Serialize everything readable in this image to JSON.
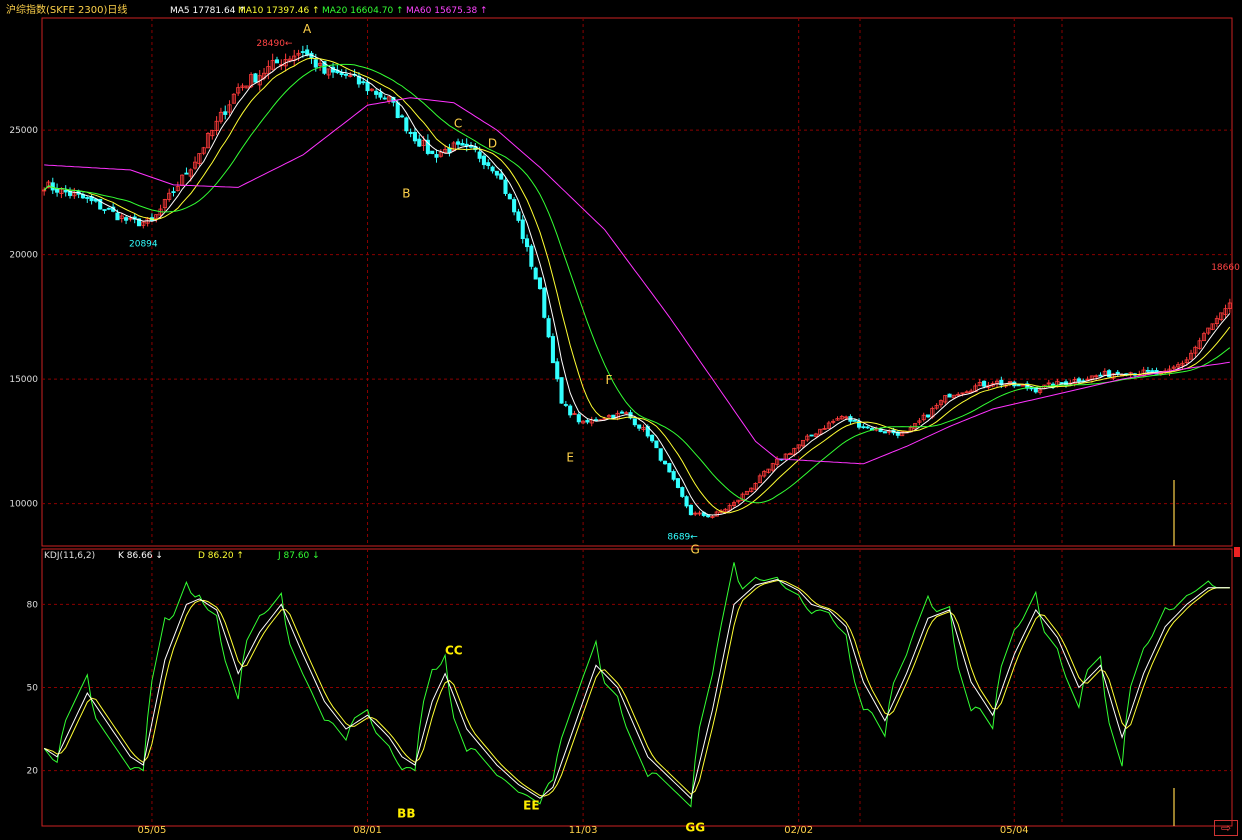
{
  "header": {
    "title": "沪综指数(SKFE 2300)日线",
    "ma_labels": [
      {
        "name": "MA5",
        "value": "17781.64",
        "arrow": "↑",
        "color": "#ffffff"
      },
      {
        "name": "MA10",
        "value": "17397.46",
        "arrow": "↑",
        "color": "#ffff33"
      },
      {
        "name": "MA20",
        "value": "16604.70",
        "arrow": "↑",
        "color": "#33ff33"
      },
      {
        "name": "MA60",
        "value": "15675.38",
        "arrow": "↑",
        "color": "#ff44ff"
      }
    ]
  },
  "kdj_header": {
    "title": "KDJ(11,6,2)",
    "values": [
      {
        "name": "K",
        "value": "86.66",
        "arrow": "↓",
        "color": "#ffffff"
      },
      {
        "name": "D",
        "value": "86.20",
        "arrow": "↑",
        "color": "#ffff33"
      },
      {
        "name": "J",
        "value": "87.60",
        "arrow": "↓",
        "color": "#33ff33"
      }
    ]
  },
  "colors": {
    "up": "#ff3b3b",
    "down": "#33ffff",
    "ma5": "#ffffff",
    "ma10": "#ffff33",
    "ma20": "#33ff33",
    "ma60": "#ff33ff",
    "grid": "#8b0000",
    "axis": "#cc2222",
    "label": "#ffd24a"
  },
  "chart_data": [
    {
      "type": "candlestick",
      "ylim": [
        8300,
        29500
      ],
      "yticks": [
        10000,
        15000,
        20000,
        25000
      ],
      "xticks": [
        "05/05",
        "08/01",
        "11/03",
        "02/02",
        "05/04"
      ],
      "xtick_index": [
        25,
        75,
        125,
        175,
        225
      ],
      "n_bars": 276,
      "close_anchors": [
        [
          0,
          22800
        ],
        [
          10,
          22200
        ],
        [
          20,
          21300
        ],
        [
          25,
          21300
        ],
        [
          35,
          23800
        ],
        [
          45,
          26700
        ],
        [
          55,
          27800
        ],
        [
          60,
          28200
        ],
        [
          65,
          27300
        ],
        [
          70,
          27200
        ],
        [
          80,
          26200
        ],
        [
          85,
          24900
        ],
        [
          90,
          24000
        ],
        [
          95,
          24300
        ],
        [
          100,
          24100
        ],
        [
          105,
          23400
        ],
        [
          110,
          21300
        ],
        [
          115,
          18500
        ],
        [
          120,
          14000
        ],
        [
          125,
          13200
        ],
        [
          130,
          13500
        ],
        [
          135,
          13600
        ],
        [
          140,
          12800
        ],
        [
          150,
          9600
        ],
        [
          155,
          9500
        ],
        [
          160,
          10000
        ],
        [
          170,
          11700
        ],
        [
          180,
          13000
        ],
        [
          185,
          13500
        ],
        [
          190,
          13100
        ],
        [
          195,
          12900
        ],
        [
          200,
          12800
        ],
        [
          210,
          14400
        ],
        [
          220,
          14900
        ],
        [
          230,
          14600
        ],
        [
          240,
          15000
        ],
        [
          250,
          15300
        ],
        [
          260,
          15200
        ],
        [
          265,
          15800
        ],
        [
          270,
          17000
        ],
        [
          275,
          17900
        ]
      ],
      "ma60_anchors": [
        [
          0,
          23600
        ],
        [
          20,
          23400
        ],
        [
          30,
          22800
        ],
        [
          45,
          22700
        ],
        [
          60,
          24000
        ],
        [
          75,
          26000
        ],
        [
          85,
          26300
        ],
        [
          95,
          26100
        ],
        [
          105,
          25000
        ],
        [
          115,
          23500
        ],
        [
          130,
          21000
        ],
        [
          145,
          17500
        ],
        [
          155,
          15000
        ],
        [
          165,
          12500
        ],
        [
          170,
          11800
        ],
        [
          180,
          11700
        ],
        [
          190,
          11600
        ],
        [
          200,
          12300
        ],
        [
          210,
          13100
        ],
        [
          220,
          13800
        ],
        [
          235,
          14400
        ],
        [
          250,
          15000
        ],
        [
          260,
          15300
        ],
        [
          276,
          15700
        ]
      ],
      "price_labels": [
        {
          "text": "28490",
          "index": 59,
          "value": 28490,
          "color": "#ff4444",
          "side": "left"
        },
        {
          "text": "20894",
          "index": 23,
          "value": 20894,
          "color": "#33ffff",
          "side": "below"
        },
        {
          "text": "8689",
          "index": 153,
          "value": 8689,
          "color": "#33ffff",
          "side": "left"
        },
        {
          "text": "18660",
          "index": 274,
          "value": 18660,
          "color": "#ff4444",
          "side": "above"
        }
      ],
      "annotations": [
        {
          "text": "A",
          "index": 61,
          "value": 28900
        },
        {
          "text": "B",
          "index": 84,
          "value": 22300
        },
        {
          "text": "C",
          "index": 96,
          "value": 25100
        },
        {
          "text": "D",
          "index": 104,
          "value": 24300
        },
        {
          "text": "E",
          "index": 122,
          "value": 11700
        },
        {
          "text": "F",
          "index": 131,
          "value": 14800
        },
        {
          "text": "G",
          "index": 151,
          "value": 8000
        }
      ]
    },
    {
      "type": "line",
      "ylim": [
        0,
        100
      ],
      "yticks": [
        20,
        50,
        80
      ],
      "k_anchors": [
        [
          0,
          28
        ],
        [
          3,
          25
        ],
        [
          10,
          48
        ],
        [
          20,
          25
        ],
        [
          23,
          22
        ],
        [
          28,
          60
        ],
        [
          33,
          80
        ],
        [
          36,
          82
        ],
        [
          40,
          78
        ],
        [
          45,
          55
        ],
        [
          50,
          70
        ],
        [
          55,
          80
        ],
        [
          60,
          62
        ],
        [
          65,
          45
        ],
        [
          70,
          35
        ],
        [
          75,
          40
        ],
        [
          80,
          32
        ],
        [
          83,
          25
        ],
        [
          86,
          22
        ],
        [
          90,
          45
        ],
        [
          93,
          55
        ],
        [
          98,
          35
        ],
        [
          105,
          22
        ],
        [
          110,
          15
        ],
        [
          115,
          10
        ],
        [
          118,
          14
        ],
        [
          125,
          45
        ],
        [
          128,
          58
        ],
        [
          133,
          50
        ],
        [
          140,
          25
        ],
        [
          146,
          16
        ],
        [
          150,
          10
        ],
        [
          155,
          42
        ],
        [
          160,
          80
        ],
        [
          165,
          87
        ],
        [
          170,
          89
        ],
        [
          175,
          85
        ],
        [
          178,
          80
        ],
        [
          182,
          78
        ],
        [
          186,
          72
        ],
        [
          190,
          52
        ],
        [
          195,
          38
        ],
        [
          200,
          55
        ],
        [
          205,
          75
        ],
        [
          210,
          78
        ],
        [
          215,
          52
        ],
        [
          220,
          40
        ],
        [
          225,
          62
        ],
        [
          230,
          78
        ],
        [
          235,
          68
        ],
        [
          240,
          50
        ],
        [
          245,
          58
        ],
        [
          250,
          32
        ],
        [
          255,
          55
        ],
        [
          260,
          72
        ],
        [
          265,
          80
        ],
        [
          270,
          86
        ],
        [
          275,
          86
        ]
      ],
      "annotations": [
        {
          "text": "CC",
          "index": 95,
          "value": 62
        },
        {
          "text": "BB",
          "index": 84,
          "value": 3
        },
        {
          "text": "EE",
          "index": 113,
          "value": 6
        },
        {
          "text": "GG",
          "index": 151,
          "value": -2
        }
      ]
    }
  ]
}
